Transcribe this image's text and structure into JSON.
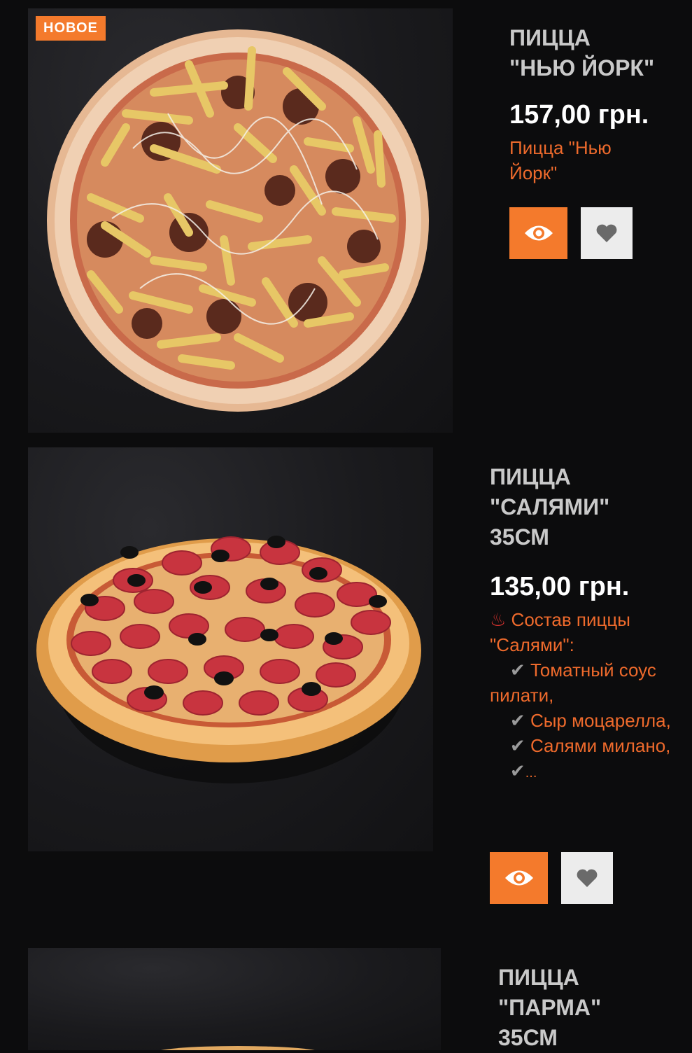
{
  "products": [
    {
      "badge": "НОВОЕ",
      "title_line1": "ПИЦЦА",
      "title_line2": "\"НЬЮ ЙОРК\"",
      "price": "157,00 грн.",
      "description": "Пицца \"Нью Йорк\""
    },
    {
      "title_line1": "ПИЦЦА",
      "title_line2": "\"САЛЯМИ\"",
      "title_line3": "35СМ",
      "price": "135,00 грн.",
      "desc_icon": "♨",
      "desc_intro": "Состав пиццы \"Салями\":",
      "ingredients": [
        "Томатный соус пилати,",
        "Сыр моцарелла,",
        "Салями милано,",
        "..."
      ]
    },
    {
      "title_line1": "ПИЦЦА",
      "title_line2": "\"ПАРМА\"",
      "title_line3": "35СМ"
    }
  ],
  "icons": {
    "view": "eye-icon",
    "favorite": "heart-icon",
    "check": "checkmark-icon"
  },
  "colors": {
    "accent": "#f47a2c",
    "description": "#ee6a2c",
    "background": "#0c0c0d"
  }
}
